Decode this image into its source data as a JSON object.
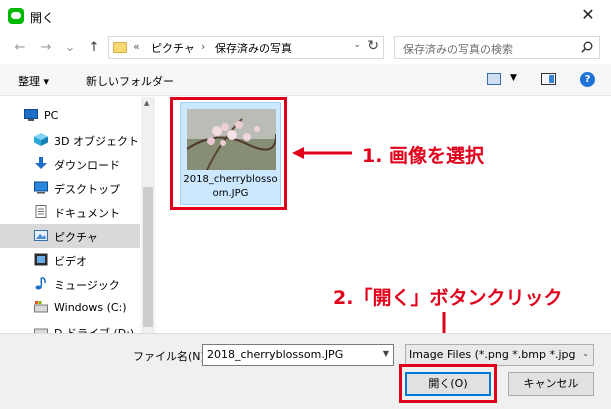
{
  "window": {
    "title": "開く",
    "close": "✕"
  },
  "nav": {
    "back": "←",
    "forward": "→",
    "recent": "⌄",
    "up": "↑",
    "crumbs": [
      "«",
      "ピクチャ",
      "›",
      "保存済みの写真"
    ],
    "refresh": "↻",
    "search_placeholder": "保存済みの写真の検索"
  },
  "toolbar": {
    "organize": "整理 ▾",
    "new_folder": "新しいフォルダー"
  },
  "sidebar": {
    "items": [
      {
        "label": "PC",
        "icon": "pc-icon"
      },
      {
        "label": "3D オブジェクト",
        "icon": "3d-objects-icon"
      },
      {
        "label": "ダウンロード",
        "icon": "download-icon"
      },
      {
        "label": "デスクトップ",
        "icon": "desktop-icon"
      },
      {
        "label": "ドキュメント",
        "icon": "document-icon"
      },
      {
        "label": "ピクチャ",
        "icon": "pictures-icon",
        "selected": true
      },
      {
        "label": "ビデオ",
        "icon": "video-icon"
      },
      {
        "label": "ミュージック",
        "icon": "music-icon"
      },
      {
        "label": "Windows (C:)",
        "icon": "drive-icon"
      },
      {
        "label": "D ドライブ (D:)",
        "icon": "drive-icon"
      }
    ]
  },
  "files": [
    {
      "name_line1": "2018_cherryblosso",
      "name_line2": "om.JPG"
    }
  ],
  "annotations": {
    "step1": "1. 画像を選択",
    "step2": "2.「開く」ボタンクリック",
    "color": "#e0001b"
  },
  "bottom": {
    "filename_label": "ファイル名(N):",
    "filename_value": "2018_cherryblossom.JPG",
    "filetype_value": "Image Files (*.png *.bmp *.jpg *.",
    "open_label": "開く(O)",
    "cancel_label": "キャンセル"
  }
}
